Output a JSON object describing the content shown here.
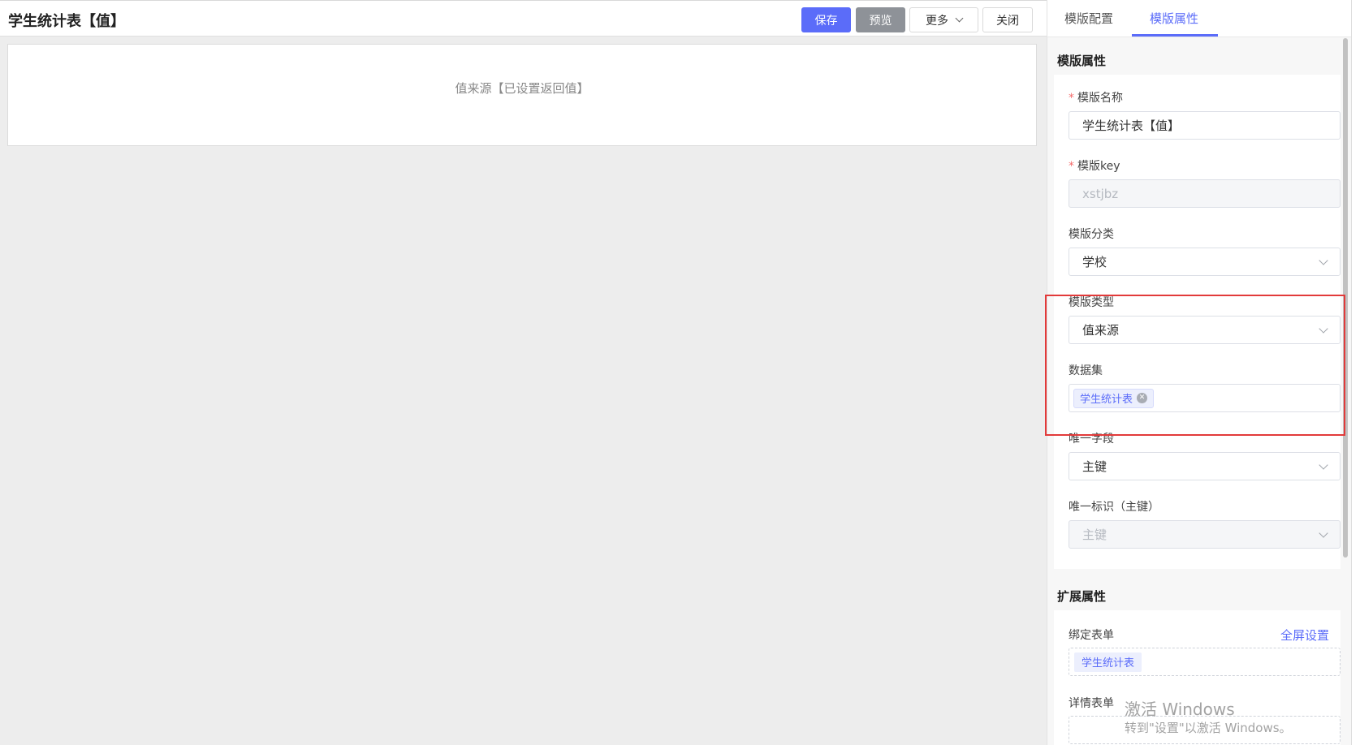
{
  "header": {
    "title": "学生统计表【值】",
    "buttons": {
      "save": "保存",
      "preview": "预览",
      "more": "更多",
      "close": "关闭"
    }
  },
  "canvas": {
    "placeholder": "值来源【已设置返回值】"
  },
  "panel": {
    "tabs": [
      {
        "label": "模版配置",
        "active": false
      },
      {
        "label": "模版属性",
        "active": true
      }
    ],
    "template_props": {
      "title": "模版属性",
      "name": {
        "label": "模版名称",
        "required": true,
        "value": "学生统计表【值】"
      },
      "key": {
        "label": "模版key",
        "required": true,
        "value": "xstjbz",
        "disabled": true
      },
      "category": {
        "label": "模版分类",
        "value": "学校"
      },
      "type": {
        "label": "模版类型",
        "value": "值来源"
      },
      "dataset": {
        "label": "数据集",
        "tags": [
          "学生统计表"
        ]
      },
      "unique_field": {
        "label": "唯一字段",
        "value": "主键"
      },
      "unique_id": {
        "label": "唯一标识（主键）",
        "value": "主键",
        "disabled": true
      }
    },
    "ext_props": {
      "title": "扩展属性",
      "bind_form": {
        "label": "绑定表单",
        "action": "全屏设置",
        "tags": [
          "学生统计表"
        ]
      },
      "detail_form": {
        "label": "详情表单"
      }
    }
  },
  "watermark": {
    "line1": "激活 Windows",
    "line2": "转到\"设置\"以激活 Windows。"
  },
  "colors": {
    "accent": "#5b6cf9",
    "highlight_border": "#e23a3a",
    "required": "#f56c6c"
  }
}
